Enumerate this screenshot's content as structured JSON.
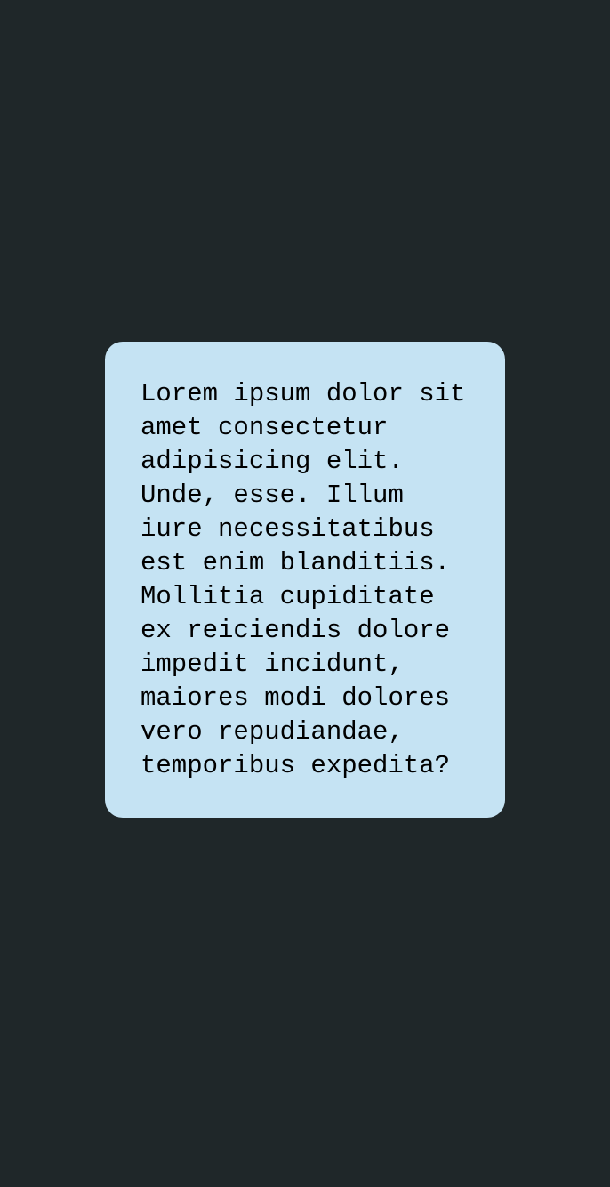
{
  "card": {
    "lines": [
      "Lorem ipsum dolor sit",
      "amet consectetur",
      "adipisicing elit.",
      "Unde, esse. Illum",
      "iure necessitatibus",
      "est enim blanditiis.",
      "Mollitia cupiditate",
      "ex reiciendis dolore",
      "impedit incidunt,",
      "maiores modi dolores",
      "vero repudiandae,",
      "temporibus expedita?"
    ]
  },
  "colors": {
    "background": "#1f2729",
    "card": "#c5e3f3",
    "text": "#000000"
  }
}
